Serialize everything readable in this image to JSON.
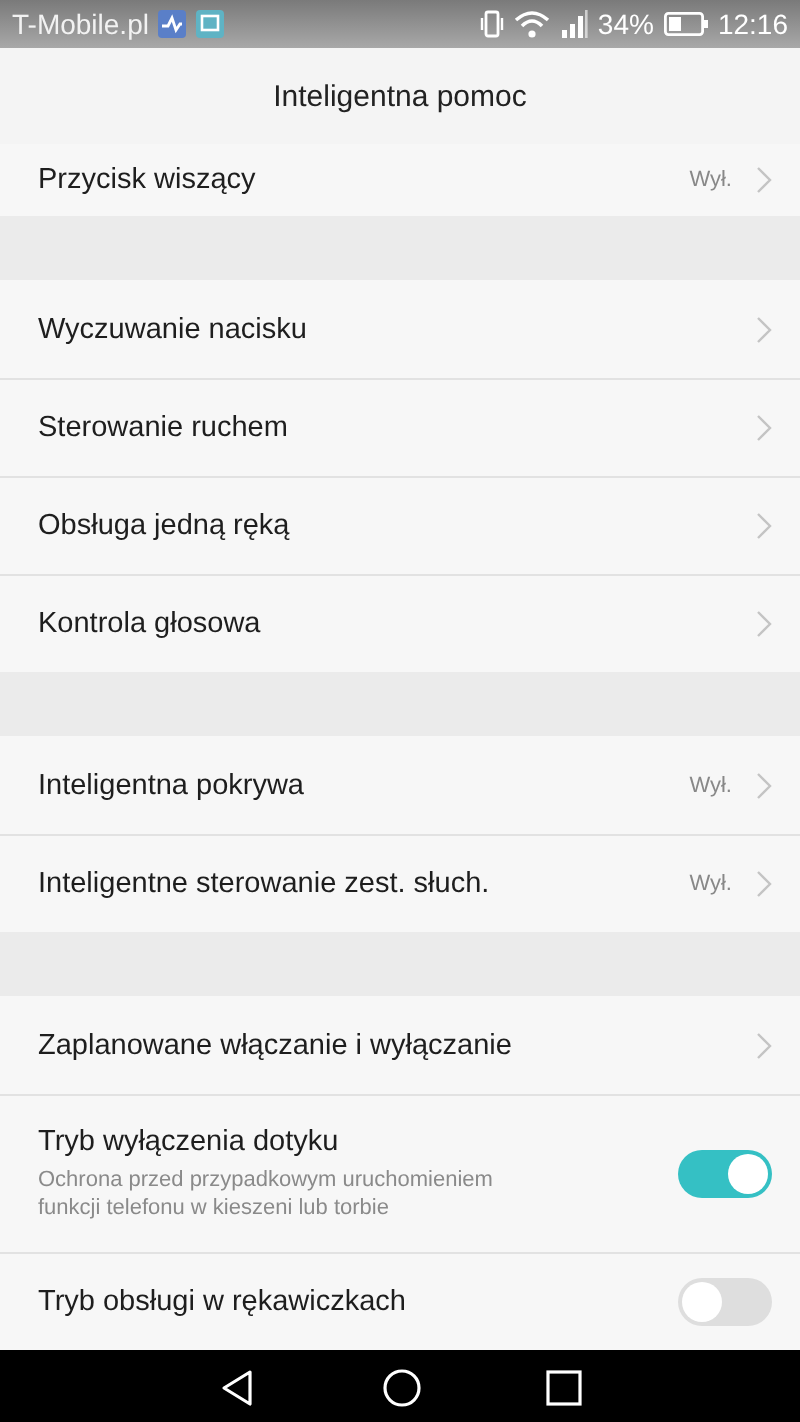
{
  "status_bar": {
    "carrier": "T-Mobile.pl",
    "battery_percent": "34%",
    "time": "12:16"
  },
  "header": {
    "title": "Inteligentna pomoc"
  },
  "groups": [
    {
      "items": [
        {
          "kind": "link",
          "label": "Przycisk wiszący",
          "value": "Wył."
        }
      ]
    },
    {
      "items": [
        {
          "kind": "link",
          "label": "Wyczuwanie nacisku"
        },
        {
          "kind": "link",
          "label": "Sterowanie ruchem"
        },
        {
          "kind": "link",
          "label": "Obsługa jedną ręką"
        },
        {
          "kind": "link",
          "label": "Kontrola głosowa"
        }
      ]
    },
    {
      "items": [
        {
          "kind": "link",
          "label": "Inteligentna pokrywa",
          "value": "Wył."
        },
        {
          "kind": "link",
          "label": "Inteligentne sterowanie zest. słuch.",
          "value": "Wył."
        }
      ]
    },
    {
      "items": [
        {
          "kind": "link",
          "label": "Zaplanowane włączanie i wyłączanie"
        },
        {
          "kind": "toggle",
          "label": "Tryb wyłączenia dotyku",
          "description": "Ochrona przed przypadkowym uruchomieniem funkcji telefonu w kieszeni lub torbie",
          "on": true
        },
        {
          "kind": "toggle",
          "label": "Tryb obsługi w rękawiczkach",
          "on": false
        }
      ]
    }
  ]
}
